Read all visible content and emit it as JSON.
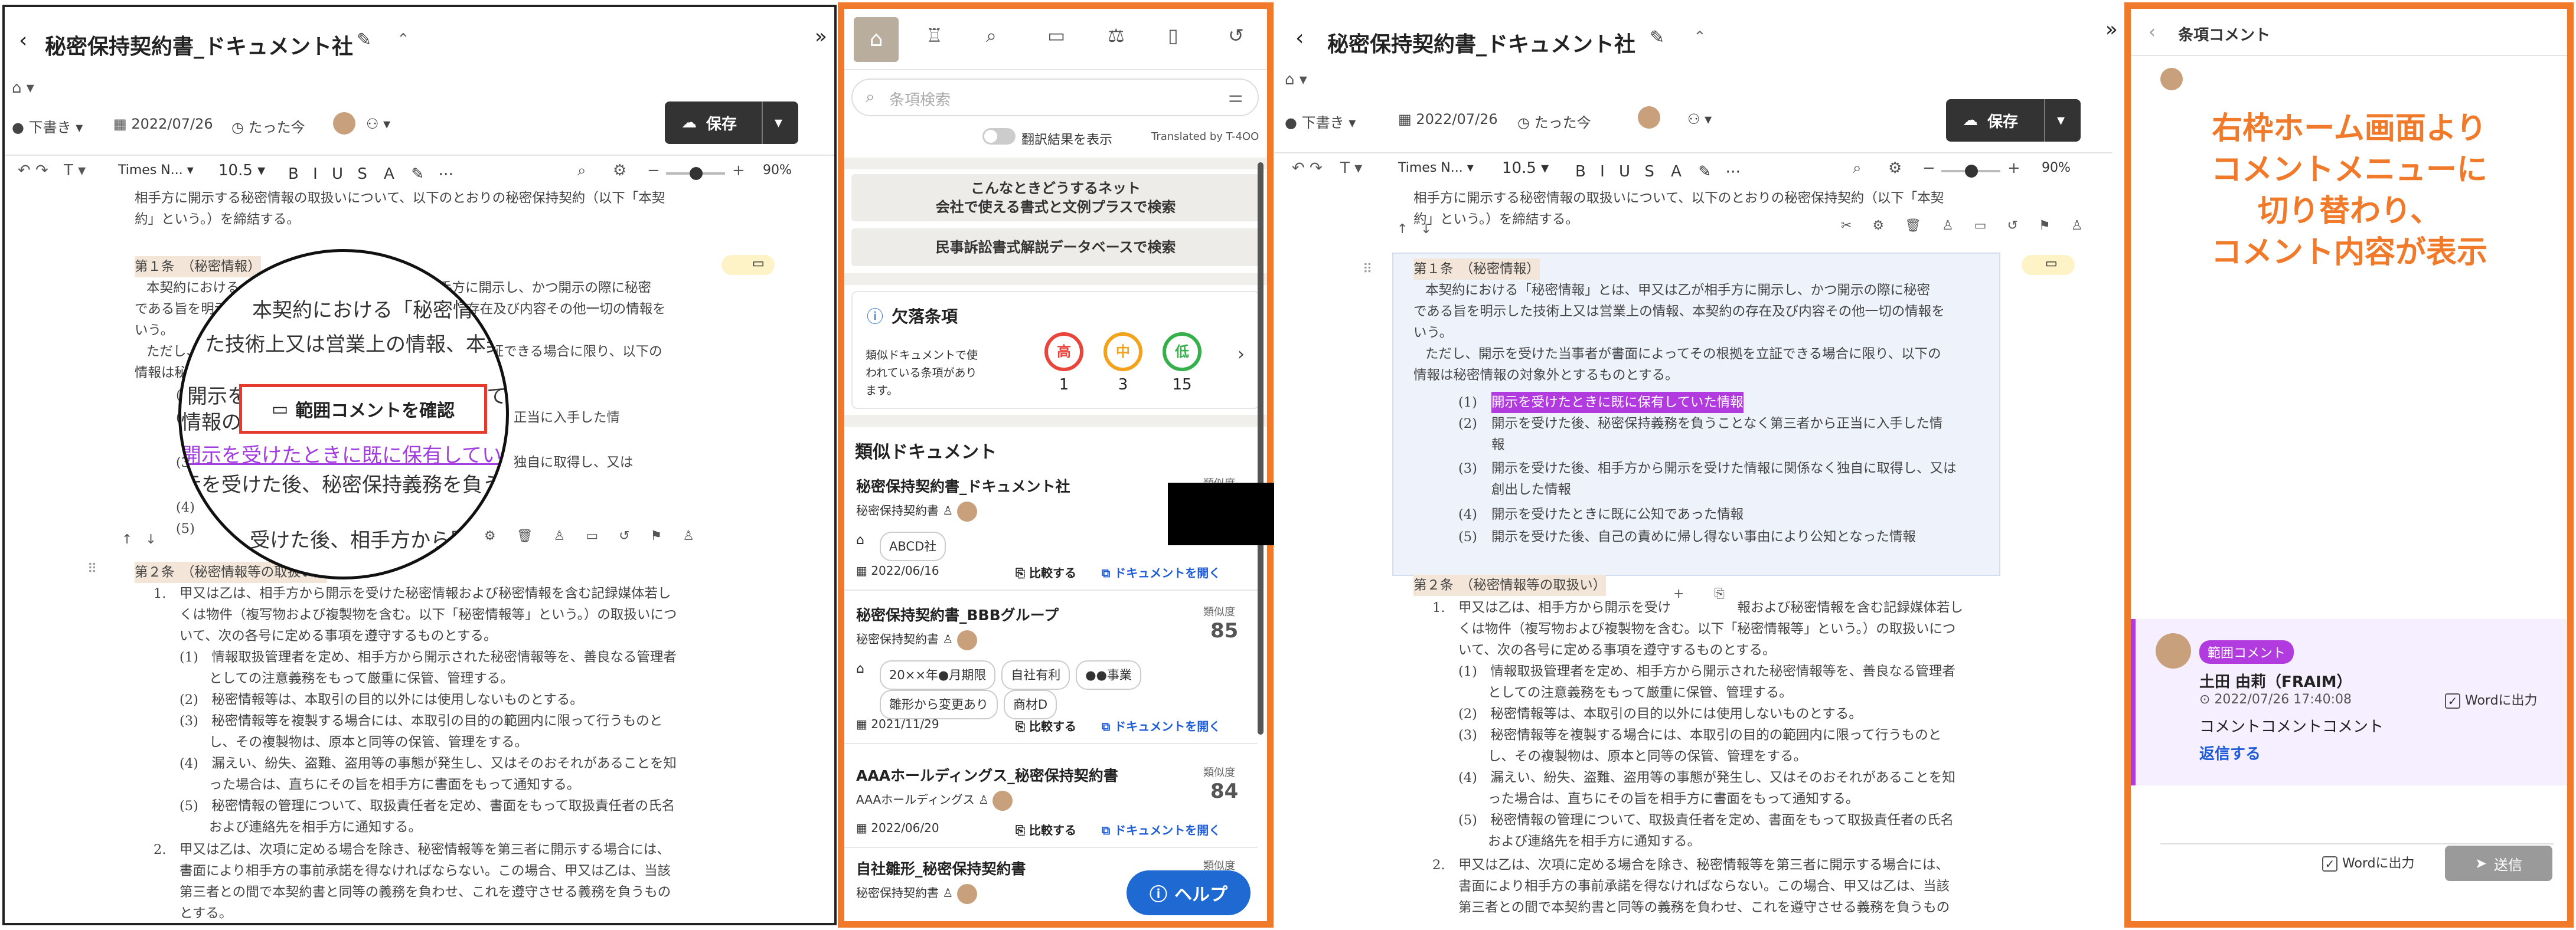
{
  "doc_title": "秘密保持契約書_ドキュメント社",
  "meta": {
    "status": "下書き",
    "date": "2022/07/26",
    "updated": "たった今"
  },
  "toolbar": {
    "save": "保存",
    "font": "Times N...",
    "size": "10.5",
    "zoom": "90%"
  },
  "left_doc": {
    "top_lines": [
      "相手方に開示する秘密情報の取扱いについて、以下のとおりの秘密保持契約（以下「本契",
      "約」という。）を締結する。"
    ],
    "art1_heading": "第１条　（秘密情報）",
    "art1_lines": [
      "本契約における「秘密情報」とは、甲又は乙が相手方に開示し、かつ開示の際に秘密",
      "である旨を明示した技術上又は営業上の情報、本契約の存在及び内容その他一切の情報を",
      "いう。",
      "ただし、開示を受けた当事者が書面によってその根拠を立証できる場合に限り、以下の",
      "情報は秘密情報の対象外とするものとする。",
      "(1)",
      "(2)　　　　　　　　　　　　　　　　　　　　　　　　正当に入手した情",
      "(3)　　　　　　　　　　　　　　　　　　　　　　　　独自に取得し、又は",
      "(4)",
      "(5)"
    ],
    "art2_heading": "第２条　（秘密情報等の取扱い）",
    "art2_lines": [
      "1.　甲又は乙は、相手方から開示を受けた秘密情報および秘密情報を含む記録媒体若し",
      "くは物件（複写物および複製物を含む。以下「秘密情報等」という。）の取扱いにつ",
      "いて、次の各号に定める事項を遵守するものとする。",
      "(1)　情報取扱管理者を定め、相手方から開示された秘密情報等を、善良なる管理者",
      "としての注意義務をもって厳重に保管、管理する。",
      "(2)　秘密情報等は、本取引の目的以外には使用しないものとする。",
      "(3)　秘密情報等を複製する場合には、本取引の目的の範囲内に限って行うものと",
      "し、その複製物は、原本と同等の保管、管理をする。",
      "(4)　漏えい、紛失、盗難、盗用等の事態が発生し、又はそのおそれがあることを知",
      "った場合は、直ちにその旨を相手方に書面をもって通知する。",
      "(5)　秘密情報の管理について、取扱責任者を定め、書面をもって取扱責任者の氏名",
      "および連絡先を相手方に通知する。",
      "2.　甲又は乙は、次項に定める場合を除き、秘密情報等を第三者に開示する場合には、",
      "書面により相手方の事前承諾を得なければならない。この場合、甲又は乙は、当該",
      "第三者との間で本契約書と同等の義務を負わせ、これを遵守させる義務を負うもの",
      "とする。"
    ]
  },
  "zoom_circle": {
    "lines": [
      "本契約における「秘密情報」とは、甲又は乙が",
      "た技術上又は営業上の情報、本契約の",
      "開示を受けた当事者が書面によってその根拠",
      "情報の",
      "開示を受けたときに既に保有していた情報",
      "示を受けた後、秘密保持義務を負うこと",
      "(4)",
      "(5)　　受けた後、相手方から開示を"
    ],
    "button": "範囲コメントを確認"
  },
  "middle": {
    "search_placeholder": "条項検索",
    "translate_label": "翻訳結果を表示",
    "translate_by": "Translated by T-4OO",
    "banner1_line1": "こんなときどうするネット",
    "banner1_line2": "会社で使える書式と文例プラスで検索",
    "banner2": "民事訴訟書式解説データベースで検索",
    "missing_title": "欠落条項",
    "missing_desc": [
      "類似ドキュメントで使",
      "われている条項があり",
      "ます。"
    ],
    "risk": [
      {
        "label": "高",
        "count": "1",
        "color": "#e8453c"
      },
      {
        "label": "中",
        "count": "3",
        "color": "#f2a31b"
      },
      {
        "label": "低",
        "count": "15",
        "color": "#35b04a"
      }
    ],
    "similar_title": "類似ドキュメント",
    "similarity_label": "類似度",
    "compare": "比較する",
    "open": "ドキュメントを開く",
    "docs": [
      {
        "title": "秘密保持契約書_ドキュメント社",
        "type": "秘密保持契約書",
        "tags": [
          "ABCD社"
        ],
        "date": "2022/06/16",
        "score": ""
      },
      {
        "title": "秘密保持契約書_BBBグループ",
        "type": "秘密保持契約書",
        "tags": [
          "20××年●月期限",
          "自社有利",
          "●●事業",
          "雛形から変更あり",
          "商材D"
        ],
        "date": "2021/11/29",
        "score": "85"
      },
      {
        "title": "AAAホールディングス_秘密保持契約書",
        "type": "AAAホールディングス",
        "tags": [],
        "date": "2022/06/20",
        "score": "84"
      },
      {
        "title": "自社雛形_秘密保持契約書",
        "type": "秘密保持契約書",
        "tags": [],
        "date": "",
        "score": ""
      }
    ],
    "help": "ヘルプ"
  },
  "right_doc": {
    "top_lines": [
      "相手方に開示する秘密情報の取扱いについて、以下のとおりの秘密保持契約（以下「本契",
      "約」という。）を締結する。"
    ],
    "art1_heading": "第１条　（秘密情報）",
    "art1_lines": [
      "本契約における「秘密情報」とは、甲又は乙が相手方に開示し、かつ開示の際に秘密",
      "である旨を明示した技術上又は営業上の情報、本契約の存在及び内容その他一切の情報を",
      "いう。",
      "ただし、開示を受けた当事者が書面によってその根拠を立証できる場合に限り、以下の",
      "情報は秘密情報の対象外とするものとする。"
    ],
    "items": [
      {
        "num": "(1)",
        "lines": [
          "開示を受けたときに既に保有していた情報"
        ]
      },
      {
        "num": "(2)",
        "lines": [
          "開示を受けた後、秘密保持義務を負うことなく第三者から正当に入手した情",
          "報"
        ]
      },
      {
        "num": "(3)",
        "lines": [
          "開示を受けた後、相手方から開示を受けた情報に関係なく独自に取得し、又は",
          "創出した情報"
        ]
      },
      {
        "num": "(4)",
        "lines": [
          "開示を受けたときに既に公知であった情報"
        ]
      },
      {
        "num": "(5)",
        "lines": [
          "開示を受けた後、自己の責めに帰し得ない事由により公知となった情報"
        ]
      }
    ],
    "art2_heading": "第２条　（秘密情報等の取扱い）",
    "art2_lines": [
      "1.　甲又は乙は、相手方から開示を受け　　　　　報および秘密情報を含む記録媒体若し",
      "くは物件（複写物および複製物を含む。以下「秘密情報等」という。）の取扱いにつ",
      "いて、次の各号に定める事項を遵守するものとする。",
      "(1)　情報取扱管理者を定め、相手方から開示された秘密情報等を、善良なる管理者",
      "としての注意義務をもって厳重に保管、管理する。",
      "(2)　秘密情報等は、本取引の目的以外には使用しないものとする。",
      "(3)　秘密情報等を複製する場合には、本取引の目的の範囲内に限って行うものと",
      "し、その複製物は、原本と同等の保管、管理をする。",
      "(4)　漏えい、紛失、盗難、盗用等の事態が発生し、又はそのおそれがあることを知",
      "った場合は、直ちにその旨を相手方に書面をもって通知する。",
      "(5)　秘密情報の管理について、取扱責任者を定め、書面をもって取扱責任者の氏名",
      "および連絡先を相手方に通知する。",
      "2.　甲又は乙は、次項に定める場合を除き、秘密情報等を第三者に開示する場合には、",
      "書面により相手方の事前承諾を得なければならない。この場合、甲又は乙は、当該",
      "第三者との間で本契約書と同等の義務を負わせ、これを遵守させる義務を負うもの"
    ]
  },
  "comment_panel": {
    "title": "条項コメント",
    "note": [
      "右枠ホーム画面より",
      "コメントメニューに",
      "切り替わり、",
      "コメント内容が表示"
    ],
    "badge": "範囲コメント",
    "author": "土田 由莉（FRAIM）",
    "timestamp": "2022/07/26 17:40:08",
    "word_output": "Wordに出力",
    "body": "コメントコメントコメント",
    "reply": "返信する",
    "send": "送信"
  }
}
